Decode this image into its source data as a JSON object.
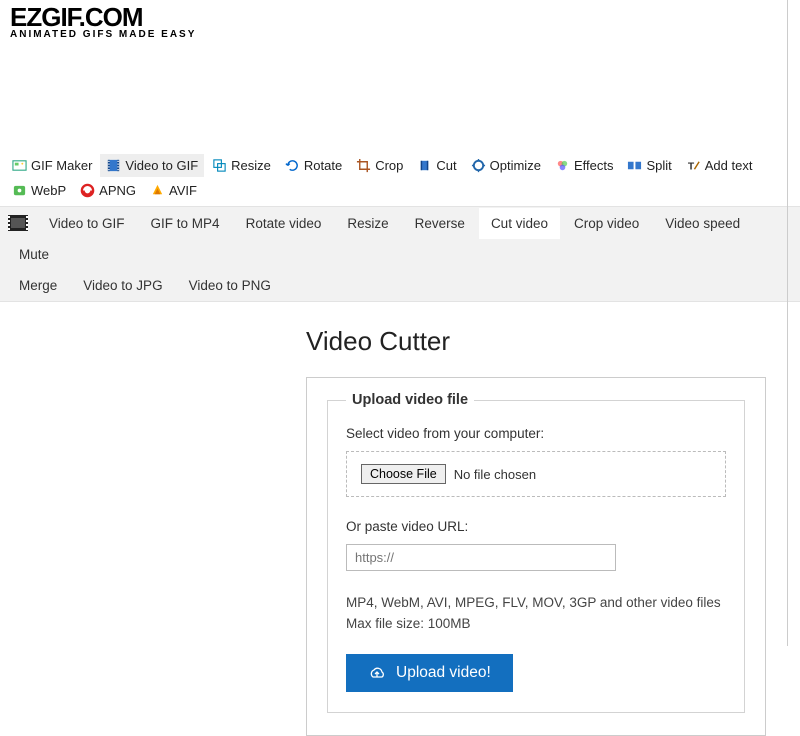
{
  "logo": {
    "main": "EZGIF.COM",
    "sub": "ANIMATED GIFS MADE EASY"
  },
  "topnav": {
    "gif_maker": "GIF Maker",
    "video_to_gif": "Video to GIF",
    "resize": "Resize",
    "rotate": "Rotate",
    "crop": "Crop",
    "cut": "Cut",
    "optimize": "Optimize",
    "effects": "Effects",
    "split": "Split",
    "add_text": "Add text",
    "webp": "WebP",
    "apng": "APNG",
    "avif": "AVIF"
  },
  "subnav": {
    "video_to_gif": "Video to GIF",
    "gif_to_mp4": "GIF to MP4",
    "rotate_video": "Rotate video",
    "resize": "Resize",
    "reverse": "Reverse",
    "cut_video": "Cut video",
    "crop_video": "Crop video",
    "video_speed": "Video speed",
    "mute": "Mute",
    "merge": "Merge",
    "video_to_jpg": "Video to JPG",
    "video_to_png": "Video to PNG"
  },
  "main": {
    "title": "Video Cutter",
    "legend": "Upload video file",
    "select_label": "Select video from your computer:",
    "choose_btn": "Choose File",
    "no_file": "No file chosen",
    "paste_label": "Or paste video URL:",
    "url_placeholder": "https://",
    "formats": "MP4, WebM, AVI, MPEG, FLV, MOV, 3GP and other video files",
    "max_size": "Max file size: 100MB",
    "upload_btn": "Upload video!"
  }
}
